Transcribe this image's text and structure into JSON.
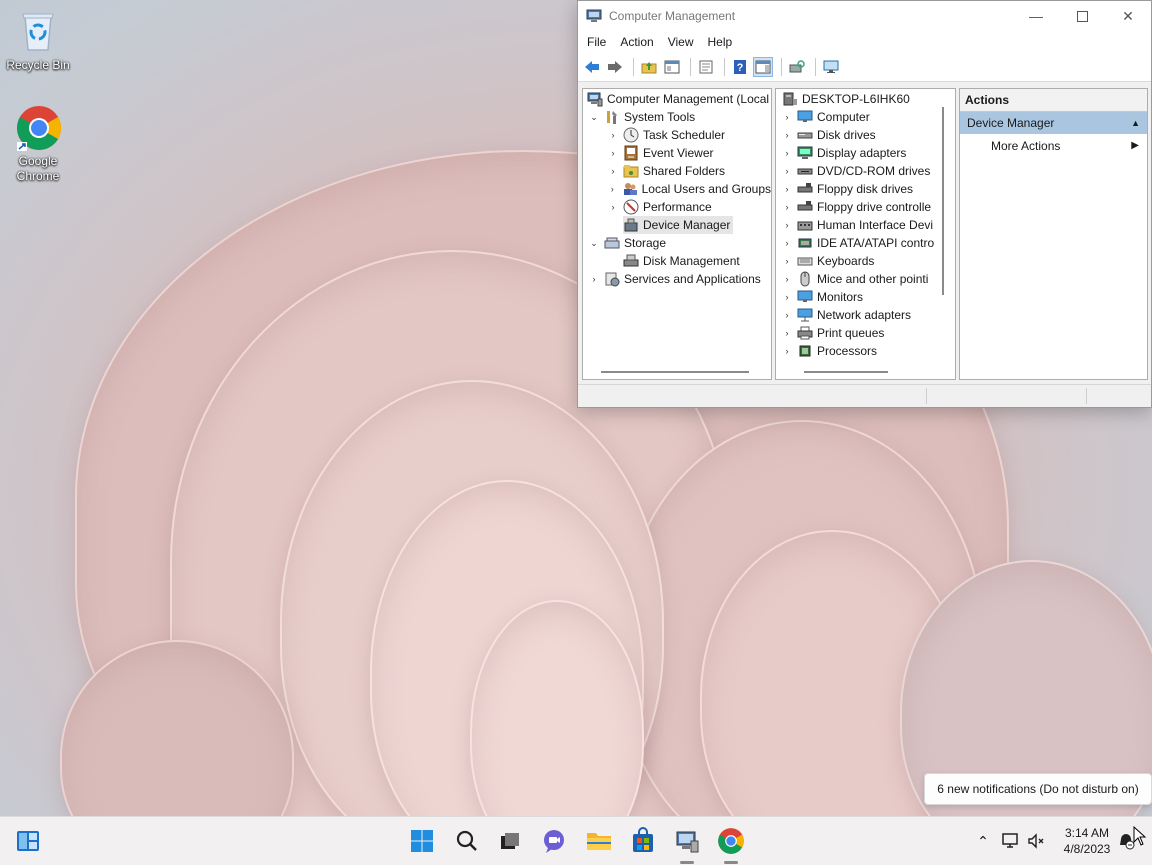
{
  "desktop": {
    "icons": [
      {
        "label": "Recycle Bin"
      },
      {
        "label": "Google Chrome"
      }
    ]
  },
  "window": {
    "title": "Computer Management",
    "menu": [
      "File",
      "Action",
      "View",
      "Help"
    ],
    "left_tree": {
      "root": "Computer Management (Local",
      "system_tools": "System Tools",
      "task_scheduler": "Task Scheduler",
      "event_viewer": "Event Viewer",
      "shared_folders": "Shared Folders",
      "local_users": "Local Users and Groups",
      "performance": "Performance",
      "device_manager": "Device Manager",
      "storage": "Storage",
      "disk_management": "Disk Management",
      "services": "Services and Applications"
    },
    "device_tree": {
      "root": "DESKTOP-L6IHK60",
      "items": [
        "Computer",
        "Disk drives",
        "Display adapters",
        "DVD/CD-ROM drives",
        "Floppy disk drives",
        "Floppy drive controlle",
        "Human Interface Devi",
        "IDE ATA/ATAPI contro",
        "Keyboards",
        "Mice and other pointi",
        "Monitors",
        "Network adapters",
        "Print queues",
        "Processors"
      ]
    },
    "actions": {
      "header": "Actions",
      "section": "Device Manager",
      "more": "More Actions"
    }
  },
  "notification": {
    "text": "6 new notifications (Do not disturb on)"
  },
  "taskbar": {
    "time": "3:14 AM",
    "date": "4/8/2023"
  },
  "colors": {
    "accent": "#0078d4",
    "selection": "#a9c5e0"
  }
}
